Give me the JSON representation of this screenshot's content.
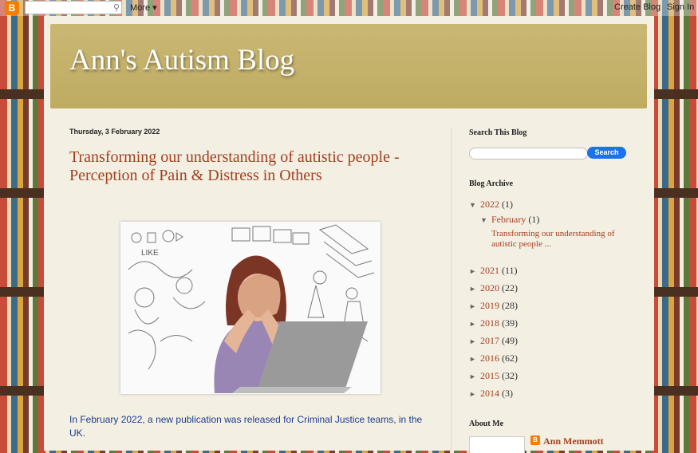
{
  "navbar": {
    "logo_icon": "blogger-logo-icon",
    "search_button_icon": "search-icon",
    "more_label": "More",
    "create_blog_label": "Create Blog",
    "sign_in_label": "Sign In"
  },
  "header": {
    "title": "Ann's Autism Blog"
  },
  "post": {
    "date": "Thursday, 3 February 2022",
    "title": "Transforming our understanding of autistic people - Perception of Pain & Distress in Others",
    "image_sketch_words": [
      "LIKE"
    ],
    "body": "In February 2022, a new publication was released for Criminal Justice teams, in the UK."
  },
  "sidebar": {
    "search_title": "Search This Blog",
    "search_button": "Search",
    "archive_title": "Blog Archive",
    "archive": [
      {
        "year": "2022",
        "count": "(1)",
        "expanded": true
      },
      {
        "month": "February",
        "count": "(1)",
        "expanded": true
      },
      {
        "post": "Transforming our understanding of autistic people ..."
      },
      {
        "year": "2021",
        "count": "(11)"
      },
      {
        "year": "2020",
        "count": "(22)"
      },
      {
        "year": "2019",
        "count": "(28)"
      },
      {
        "year": "2018",
        "count": "(39)"
      },
      {
        "year": "2017",
        "count": "(49)"
      },
      {
        "year": "2016",
        "count": "(62)"
      },
      {
        "year": "2015",
        "count": "(32)"
      },
      {
        "year": "2014",
        "count": "(3)"
      }
    ],
    "about_title": "About Me",
    "about_name": "Ann Memmott"
  },
  "colors": {
    "accent": "#a2401f",
    "header_bg": "#c4b26a",
    "page_bg": "#f4efe3",
    "link_blue": "#1a3d8c",
    "search_button": "#1a73e8"
  }
}
